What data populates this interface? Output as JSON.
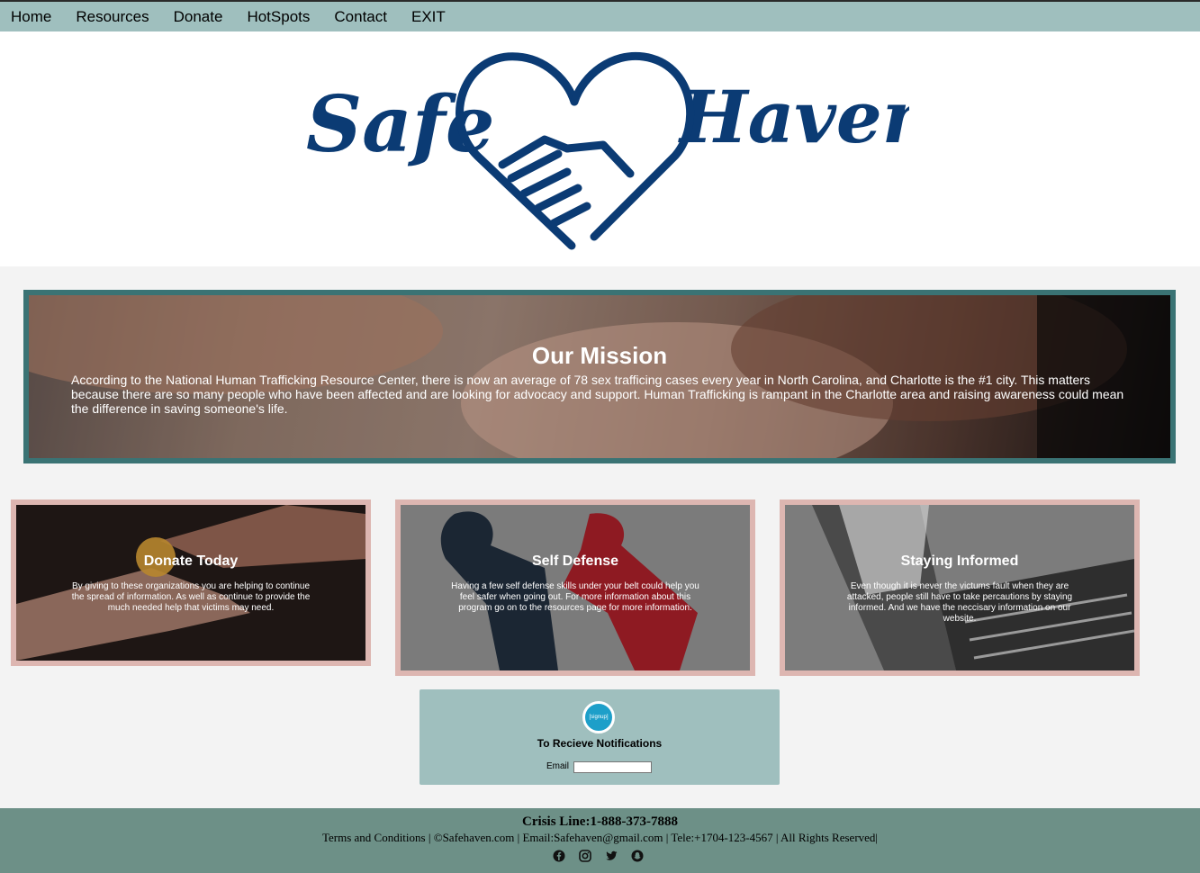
{
  "nav": {
    "items": [
      "Home",
      "Resources",
      "Donate",
      "HotSpots",
      "Contact",
      "EXIT"
    ]
  },
  "logo": {
    "text_left": "Safe",
    "text_right": "Haven"
  },
  "mission": {
    "title": "Our Mission",
    "body": "According to the National Human Trafficking Resource Center, there is now an average of 78 sex trafficing cases every year in North Carolina, and Charlotte is the #1 city. This matters because there are so many people who have been affected and are looking for advocacy and support. Human Trafficking is rampant in the Charlotte area and raising awareness could mean the difference in saving someone's life."
  },
  "cards": [
    {
      "title": "Donate Today",
      "text": "By giving to these organizations you are helping to continue the spread of information. As well as continue to provide the much needed help that victims may need."
    },
    {
      "title": "Self Defense",
      "text": "Having a few self defense skills under your belt could help you feel safer when going out. For more information about this program go on to the resources page for more information."
    },
    {
      "title": "Staying Informed",
      "text": "Even though it is never the victums fault when they are attacked, people still have to take percautions by staying informed. And we have the neccisary information on our website."
    }
  ],
  "signup": {
    "badge": "[signup]",
    "title": "To Recieve Notifications",
    "email_label": "Email",
    "email_value": ""
  },
  "footer": {
    "crisis": "Crisis Line:1-888-373-7888",
    "line": "Terms and Conditions | ©Safehaven.com | Email:Safehaven@gmail.com | Tele:+1704-123-4567 | All Rights Reserved|",
    "socials": [
      "facebook-icon",
      "instagram-icon",
      "twitter-icon",
      "snapchat-icon"
    ]
  },
  "colors": {
    "nav_bg": "#9fbfbe",
    "logo_blue": "#0b3b74",
    "mission_border": "#3a7374",
    "card_border": "#ddb6b1",
    "footer_bg": "#6d9087"
  }
}
